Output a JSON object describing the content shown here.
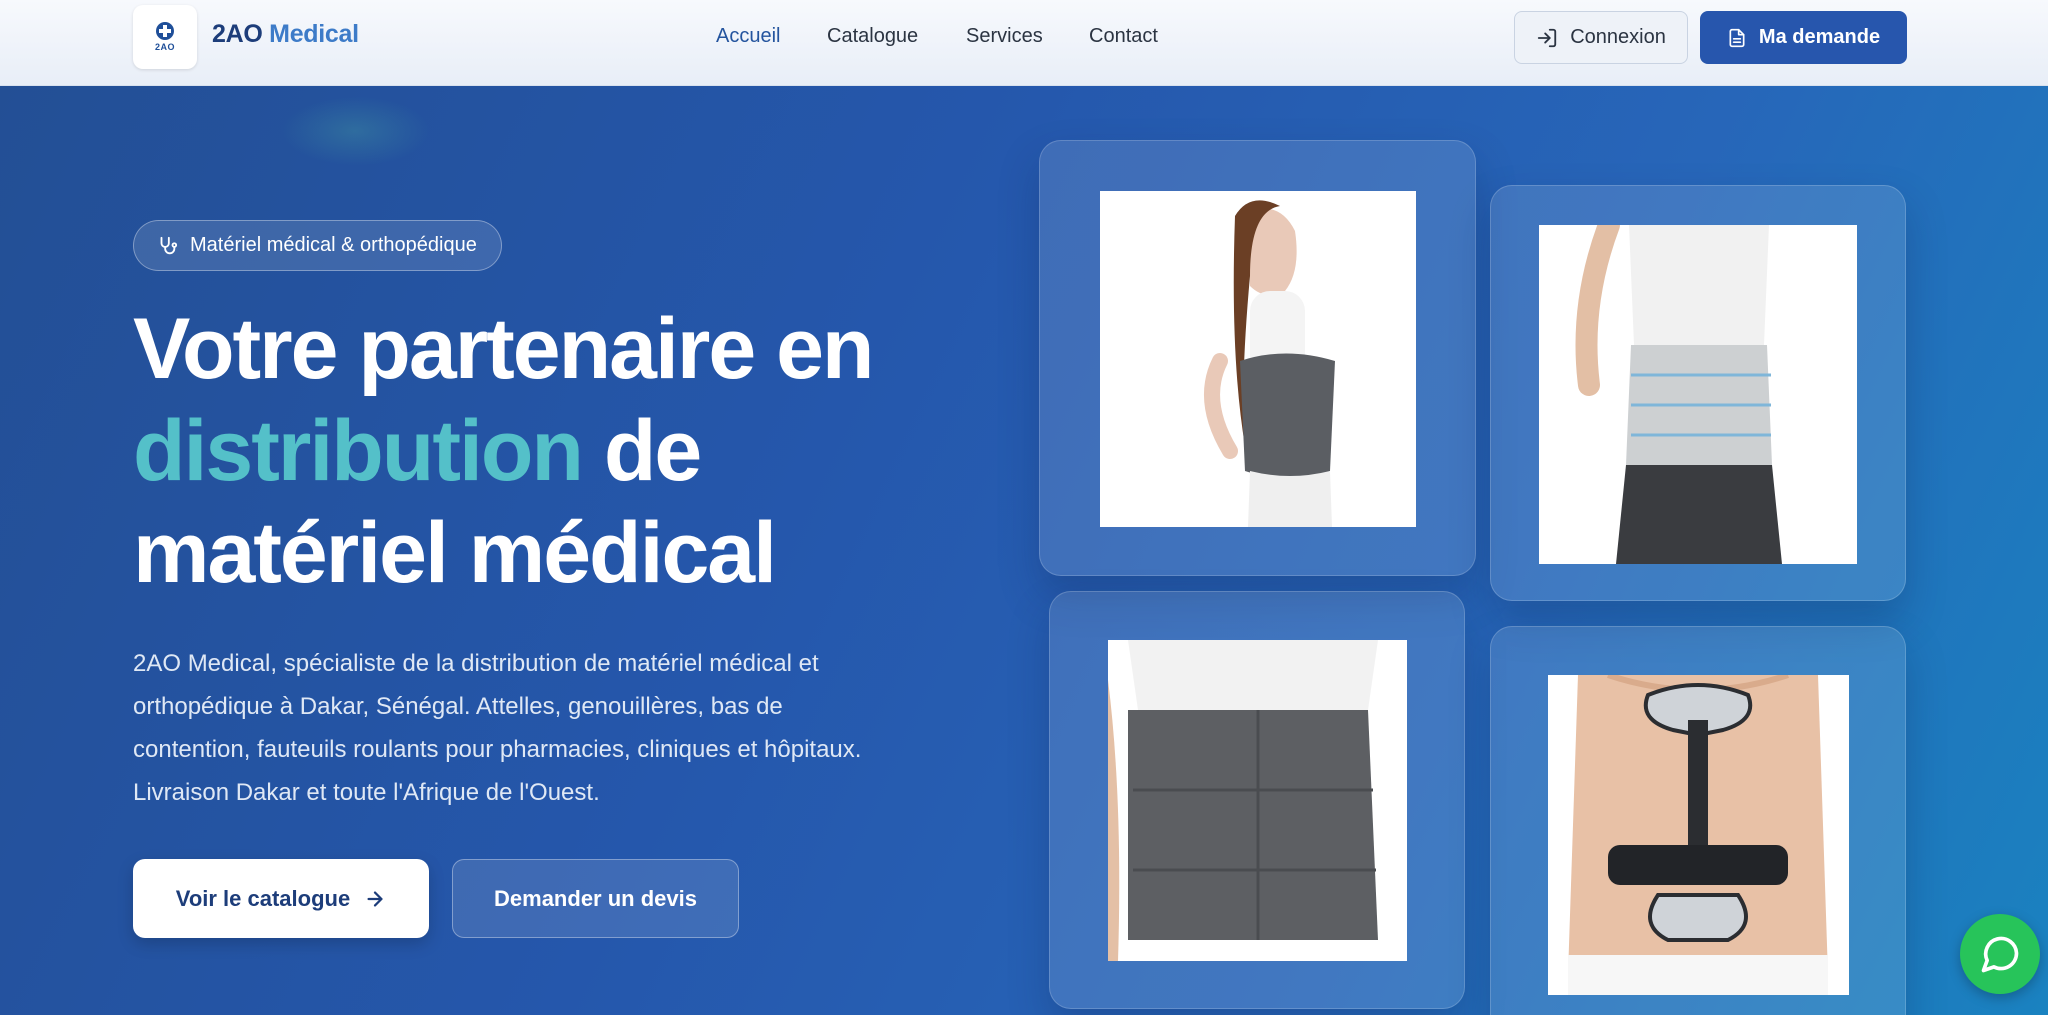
{
  "header": {
    "logo_mini": "2AO",
    "brand_part1": "2AO",
    "brand_part2": "Medical",
    "nav": [
      "Accueil",
      "Catalogue",
      "Services",
      "Contact"
    ],
    "active_nav": "Accueil",
    "login_label": "Connexion",
    "request_label": "Ma demande"
  },
  "hero": {
    "badge": "Matériel médical & orthopédique",
    "title_line1": "Votre partenaire en",
    "title_accent": "distribution",
    "title_line2_rest": " de",
    "title_line3": "matériel médical",
    "lead": "2AO Medical, spécialiste de la distribution de matériel médical et orthopédique à Dakar, Sénégal. Attelles, genouillères, bas de contention, fauteuils roulants pour pharmacies, cliniques et hôpitaux. Livraison Dakar et toute l'Afrique de l'Ouest.",
    "cta_primary": "Voir le catalogue",
    "cta_secondary": "Demander un devis"
  },
  "colors": {
    "primary": "#2756ad",
    "accent": "#54c0c9",
    "whatsapp": "#27c45a"
  },
  "icons": [
    "stethoscope-icon",
    "login-icon",
    "document-icon",
    "arrow-right-icon",
    "chat-icon"
  ]
}
